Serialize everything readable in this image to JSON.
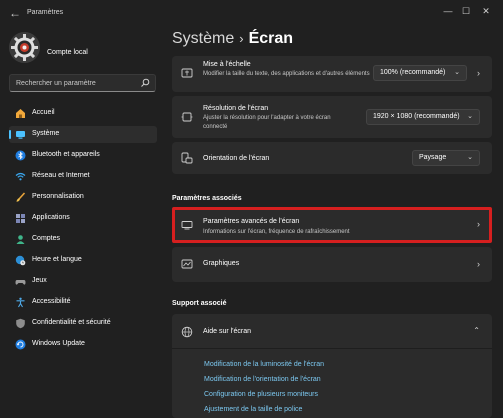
{
  "window": {
    "title": "Paramètres",
    "controls": [
      "—",
      "☐",
      "✕"
    ]
  },
  "account": {
    "name": "Compte local"
  },
  "search": {
    "placeholder": "Rechercher un paramètre"
  },
  "sidebar": {
    "items": [
      {
        "label": "Accueil",
        "icon": "home-icon",
        "active": false
      },
      {
        "label": "Système",
        "icon": "system-icon",
        "active": true
      },
      {
        "label": "Bluetooth et appareils",
        "icon": "bluetooth-icon",
        "active": false
      },
      {
        "label": "Réseau et Internet",
        "icon": "wifi-icon",
        "active": false
      },
      {
        "label": "Personnalisation",
        "icon": "brush-icon",
        "active": false
      },
      {
        "label": "Applications",
        "icon": "apps-icon",
        "active": false
      },
      {
        "label": "Comptes",
        "icon": "accounts-icon",
        "active": false
      },
      {
        "label": "Heure et langue",
        "icon": "globe-clock-icon",
        "active": false
      },
      {
        "label": "Jeux",
        "icon": "gamepad-icon",
        "active": false
      },
      {
        "label": "Accessibilité",
        "icon": "accessibility-icon",
        "active": false
      },
      {
        "label": "Confidentialité et sécurité",
        "icon": "shield-icon",
        "active": false
      },
      {
        "label": "Windows Update",
        "icon": "update-icon",
        "active": false
      }
    ]
  },
  "breadcrumb": {
    "parent": "Système",
    "separator": "›",
    "current": "Écran"
  },
  "settings": {
    "scale": {
      "title": "Mise à l'échelle",
      "desc": "Modifier la taille du texte, des applications et d'autres éléments",
      "value": "100% (recommandé)"
    },
    "resolution": {
      "title": "Résolution de l'écran",
      "desc": "Ajuster la résolution pour l'adapter à votre écran connecté",
      "value": "1920 × 1080 (recommandé)"
    },
    "orientation": {
      "title": "Orientation de l'écran",
      "value": "Paysage"
    }
  },
  "related": {
    "title": "Paramètres associés",
    "advanced": {
      "title": "Paramètres avancés de l'écran",
      "desc": "Informations sur l'écran, fréquence de rafraîchissement"
    },
    "graphics": {
      "title": "Graphiques"
    }
  },
  "support": {
    "title": "Support associé",
    "help": {
      "title": "Aide sur l'écran"
    },
    "links": [
      "Modification de la luminosité de l'écran",
      "Modification de l'orientation de l'écran",
      "Configuration de plusieurs moniteurs",
      "Ajustement de la taille de police"
    ]
  },
  "colors": {
    "accent": "#4cc2ff",
    "highlight": "#d61f1f",
    "link": "#7cc8f0"
  }
}
